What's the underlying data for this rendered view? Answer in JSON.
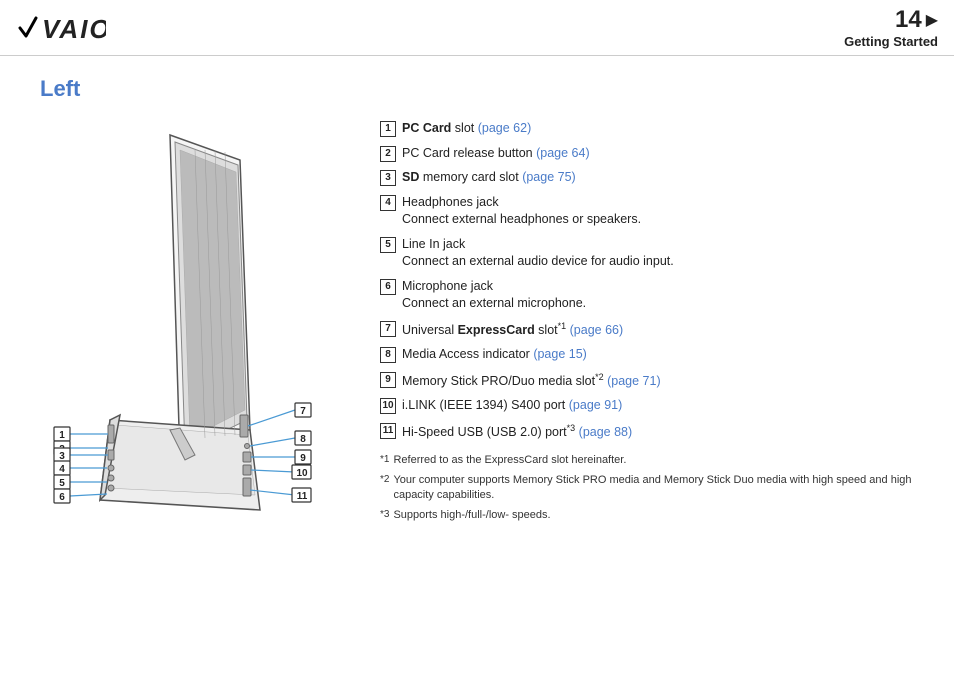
{
  "header": {
    "logo": "VAIO",
    "page_number": "14",
    "arrow": "▶",
    "section_title": "Getting Started"
  },
  "page_heading": "Left",
  "items": [
    {
      "num": "1",
      "text_before": "",
      "bold": "PC Card",
      "text_mid": " slot ",
      "link": "(page 62)",
      "sub": ""
    },
    {
      "num": "2",
      "text_before": "PC Card release button ",
      "bold": "",
      "text_mid": "",
      "link": "(page 64)",
      "sub": ""
    },
    {
      "num": "3",
      "text_before": "",
      "bold": "SD",
      "text_mid": " memory card slot ",
      "link": "(page 75)",
      "sub": ""
    },
    {
      "num": "4",
      "text_before": "Headphones jack",
      "bold": "",
      "text_mid": "",
      "link": "",
      "sub": "Connect external headphones or speakers."
    },
    {
      "num": "5",
      "text_before": "Line In jack",
      "bold": "",
      "text_mid": "",
      "link": "",
      "sub": "Connect an external audio device for audio input."
    },
    {
      "num": "6",
      "text_before": "Microphone jack",
      "bold": "",
      "text_mid": "",
      "link": "",
      "sub": "Connect an external microphone."
    },
    {
      "num": "7",
      "text_before": "Universal ",
      "bold": "ExpressCard",
      "text_mid": " slot",
      "sup": "*1",
      "link": " (page 66)",
      "sub": ""
    },
    {
      "num": "8",
      "text_before": "Media Access indicator ",
      "bold": "",
      "text_mid": "",
      "link": "(page 15)",
      "sub": ""
    },
    {
      "num": "9",
      "text_before": "Memory Stick PRO/Duo media slot",
      "bold": "",
      "text_mid": "",
      "sup": "*2",
      "link": " (page 71)",
      "sub": ""
    },
    {
      "num": "10",
      "text_before": "i.LINK (IEEE 1394) S400 port ",
      "bold": "",
      "text_mid": "",
      "link": "(page 91)",
      "sub": ""
    },
    {
      "num": "11",
      "text_before": "Hi-Speed USB (USB 2.0) port",
      "bold": "",
      "text_mid": "",
      "sup": "*3",
      "link": " (page 88)",
      "sub": ""
    }
  ],
  "footnotes": [
    {
      "mark": "*1",
      "text": "Referred to as the ExpressCard slot hereinafter."
    },
    {
      "mark": "*2",
      "text": "Your computer supports Memory Stick PRO media and Memory Stick Duo media with high speed and high capacity capabilities."
    },
    {
      "mark": "*3",
      "text": "Supports high-/full-/low- speeds."
    }
  ]
}
